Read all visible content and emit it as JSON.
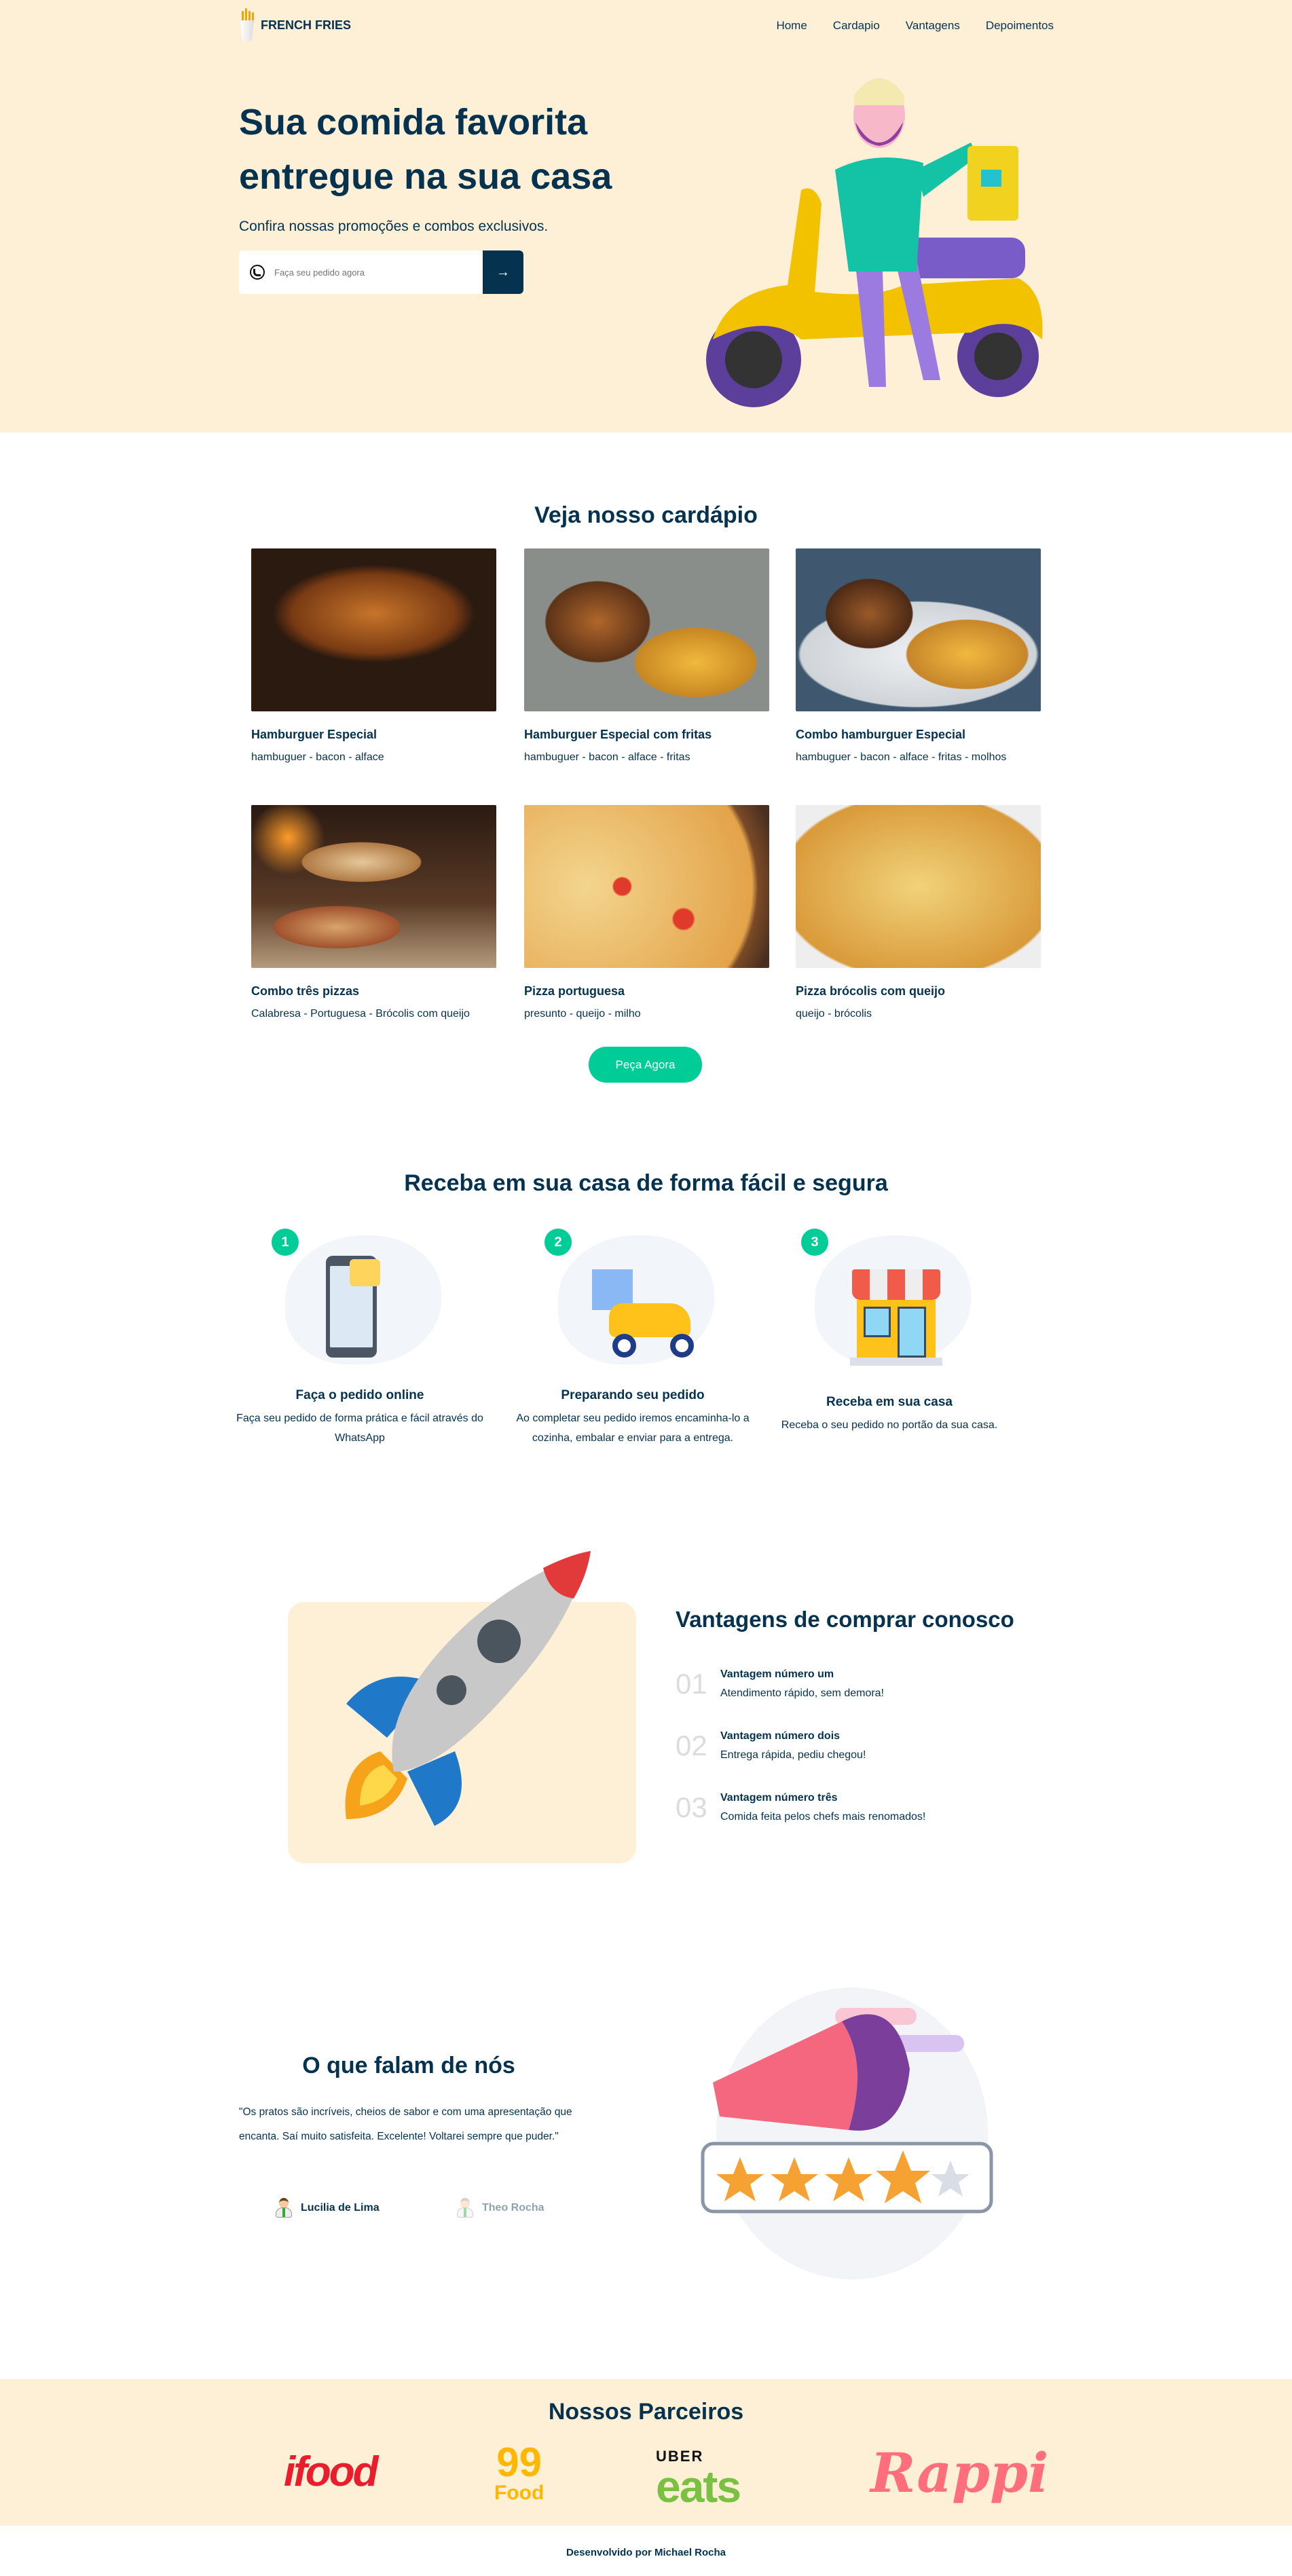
{
  "header": {
    "brand": "FRENCH FRIES",
    "nav": [
      "Home",
      "Cardapio",
      "Vantagens",
      "Depoimentos"
    ]
  },
  "hero": {
    "title_line1": "Sua comida favorita",
    "title_line2": "entregue na sua casa",
    "subtitle": "Confira nossas promoções e combos exclusivos.",
    "input_placeholder": "Faça seu pedido agora",
    "submit_icon": "→"
  },
  "menu": {
    "title": "Veja nosso cardápio",
    "items": [
      {
        "name": "Hamburguer Especial",
        "desc": "hambuguer - bacon - alface"
      },
      {
        "name": "Hamburguer Especial com fritas",
        "desc": "hambuguer - bacon - alface - fritas"
      },
      {
        "name": "Combo hamburguer Especial",
        "desc": "hambuguer - bacon - alface - fritas - molhos"
      },
      {
        "name": "Combo três pizzas",
        "desc": "Calabresa - Portuguesa - Brócolis com queijo"
      },
      {
        "name": "Pizza portuguesa",
        "desc": "presunto - queijo - milho"
      },
      {
        "name": "Pizza brócolis com queijo",
        "desc": "queijo - brócolis"
      }
    ],
    "cta": "Peça Agora"
  },
  "delivery": {
    "title": "Receba em sua casa de forma fácil e segura",
    "steps": [
      {
        "num": "1",
        "title": "Faça o pedido online",
        "desc": "Faça seu pedido de forma prática e fácil através do WhatsApp"
      },
      {
        "num": "2",
        "title": "Preparando seu pedido",
        "desc": "Ao completar seu pedido iremos encaminha-lo a cozinha, embalar e enviar para a entrega."
      },
      {
        "num": "3",
        "title": "Receba em sua casa",
        "desc": "Receba o seu pedido no portão da sua casa."
      }
    ]
  },
  "advantages": {
    "title": "Vantagens de comprar conosco",
    "items": [
      {
        "num": "01",
        "title": "Vantagem número um",
        "desc": "Atendimento rápido, sem demora!"
      },
      {
        "num": "02",
        "title": "Vantagem número dois",
        "desc": "Entrega rápida, pediu chegou!"
      },
      {
        "num": "03",
        "title": "Vantagem número três",
        "desc": "Comida feita pelos chefs mais renomados!"
      }
    ]
  },
  "testimonials": {
    "title": "O que falam de nós",
    "quote": "\"Os pratos são incríveis, cheios de sabor e com uma apresentação que encanta. Saí muito satisfeita. Excelente! Voltarei sempre que puder.\"",
    "authors": [
      "Lucilia de Lima",
      "Theo Rocha"
    ]
  },
  "partners": {
    "title": "Nossos Parceiros",
    "logos": [
      "ifood",
      "99",
      "Food",
      "UBER",
      "eats",
      "Rappi"
    ]
  },
  "footer": {
    "text": "Desenvolvido por Michael Rocha"
  },
  "colors": {
    "navy": "#04324f",
    "beige": "#fef0d7",
    "green": "#00cc98"
  }
}
